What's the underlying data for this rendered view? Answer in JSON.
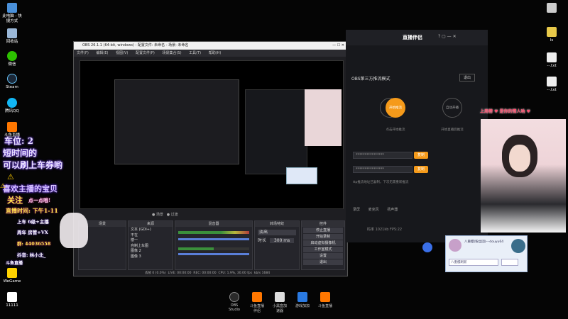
{
  "desktop_left": [
    "此电脑 - 快\n捷方式",
    "回收站",
    "微信",
    "Steam",
    "腾讯QQ",
    "斗鱼直播",
    "WeGame",
    "11111"
  ],
  "desktop_right": [
    "",
    "ls",
    "--.txt",
    "--.txt"
  ],
  "obs": {
    "title": "OBS 26.1.1 (64-bit, windows) - 配置文件: 未命名 - 场景: 未命名",
    "menu": [
      "文件(F)",
      "编辑(E)",
      "视图(V)",
      "配置文件(P)",
      "场景集合(S)",
      "工具(T)",
      "帮助(H)"
    ],
    "tabs": [
      "场景",
      "来源",
      "混音器",
      "转场特效",
      "控件"
    ],
    "scenes": [
      "文本 (GDI+)",
      "不在",
      "楼一",
      "自制上车图",
      "图像 2",
      "图像 3"
    ],
    "transition": {
      "type": "淡出",
      "duration_label": "时长",
      "duration": "300 ms"
    },
    "controls": [
      "停止直播",
      "开始录制",
      "启动虚拟摄像机",
      "工作室模式",
      "设置",
      "退出"
    ],
    "status": [
      "丢帧 0 (0.0%)",
      "LIVE: 00:00:00",
      "REC: 00:00:00",
      "CPU: 1.9%, 30.00 fps",
      "kb/s",
      "1684"
    ]
  },
  "overlay_text": {
    "car_line1": "车位: 2",
    "car_line2": "短时间的",
    "car_line3": "可以刷上车券哟",
    "welcome": "喜欢主播的宝贝",
    "follow": "关注",
    "follow_small": "点一点哦!",
    "live_time": "直播时间: 下午1-11",
    "rows": [
      "上车 6级+主播",
      "周年 房管+VX",
      "群: 44036558",
      "抖音:  林小北_",
      "斗鱼直播"
    ]
  },
  "app": {
    "title": "直播伴侣",
    "mode": "OBS第三方推流模式",
    "exit": "退出",
    "steps": [
      "1",
      "开始推流",
      "自动开播"
    ],
    "step_notes": [
      "第二方直播软件",
      "点击开始推流",
      "开始直播后推流"
    ],
    "field1": "****************",
    "field2": "****************",
    "copy": "复制",
    "hint": "ttp推流地址已复制，下次无需重新推流",
    "bottom": [
      "录屏",
      "麦克风",
      "扬声器"
    ],
    "kbps": "码率 1021kb  FPS:22"
  },
  "cam_caption": "上周榜 ♥ 是你的情人呐 ♥",
  "chat": {
    "name": "八重樱(粉丝团)---douyu64",
    "msg": "八重樱刷新"
  },
  "taskbar": [
    "OBS Studio",
    "斗鱼直播伴侣",
    "小黑盒加速器",
    "游戏加加",
    "斗鱼直播"
  ]
}
